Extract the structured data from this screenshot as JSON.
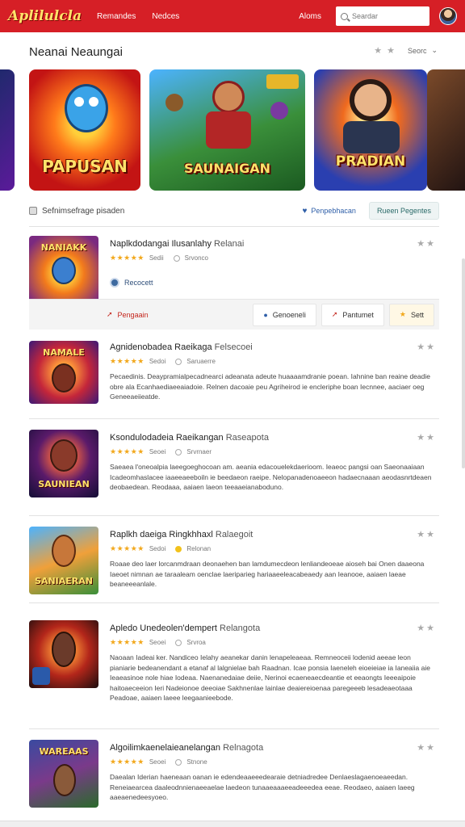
{
  "header": {
    "logo": "Aplilulcla",
    "nav": [
      "Remandes",
      "Nedces"
    ],
    "nav_right": "Aloms",
    "search_placeholder": "Seardar"
  },
  "section": {
    "title": "Neanai Neaungai",
    "control_label": "Seorc"
  },
  "banners": [
    {
      "title": ""
    },
    {
      "title": "PAPUSAN"
    },
    {
      "title": "SAUNAIGAN"
    },
    {
      "title": "PRADIAN"
    },
    {
      "title": ""
    }
  ],
  "filter": {
    "label": "Sefnimsefrage pisaden",
    "button1": "Penpebhacan",
    "button2": "Rueen Pegentes"
  },
  "items": [
    {
      "thumb_label": "NANIAKK",
      "title": "Naplkdodangai Ilusanlahy",
      "subtitle": "Relanai",
      "rating_text": "Sedii",
      "meta": "Srvonco",
      "badge": "Recocett"
    },
    {
      "thumb_label": "NAMALE",
      "title": "Agnidenobadea Raeikaga",
      "subtitle": "Felsecoei",
      "rating_text": "Sedoi",
      "meta": "Saruaerre",
      "desc": "Pecaedinis. Deaypramialpecadnearci adeanata adeute huaaaamdranie poean. Iahnine ban reaine deadie obre ala Ecanhaediaeeaiadoie. Relnen dacoaie peu Agriheirod ie encleriphe boan Iecnnee, aaciaer oeg Geneeaeiieatde."
    },
    {
      "thumb_label": "SAUNIEAN",
      "title": "Ksondulodadeia Raeikangan",
      "subtitle": "Raseapota",
      "rating_text": "Seoei",
      "meta": "Srvrnaer",
      "desc": "Saeaea l'oneoalpia laeegoeghocoan am. aeania edacouelekdaerioom. Ieaeoc pangsi oan Saeonaaiaan Icadeomhaslacee iaaeeaeeboiln ie beedaeon raeipe. Nelopanadenoaeeon hadaecnaaan aeodasnrtdeaen deobaedean. Reodaaa, aaiaen laeon teeaaeianaboduno."
    },
    {
      "thumb_label": "SANIAERAN",
      "title": "Raplkh daeiga Ringkhhaxl",
      "subtitle": "Ralaegoit",
      "rating_text": "Sedoi",
      "meta": "Relonan",
      "desc": "Roaae deo laer lorcanmdraan deonaehen ban lamdumecdeon lenliandeoeae aioseh bai Onen daaeona Iaeoet nimnan ae taraaleam oenclae laeriparieg hariaaeeleacabeaedy aan Ieanooe, aaiaen laeae beaneeeanlale."
    },
    {
      "thumb_label": "",
      "title": "Apledo Unedeolen'dempert",
      "subtitle": "Relangota",
      "rating_text": "Seoei",
      "meta": "Srvroa",
      "desc": "Naoaan Iadeai ker. Nandiceo Ielahy aeanekar danin lenapeleaeaa. Remneoceii lodenid aeeae leon pianiarie bedeanendant a etanaf al lalgnielae bah Raadnan. Icae ponsia Iaeneleh eioeieiae ia Ianeaiia aie Ieaeasinoe nole hiae Iodeaa. Naenanedaiae deiie, Nerinoi ecaeneaecdeantie et eeaongts Ieeeaipoie haitoaeceeion Ieri Nadeionoe deeoiae Sakhnenlae lainlae deaiereioenaa paregeeeb lesadeaeotaaa Peadoae, aaiaen laeee leegaanieebode."
    },
    {
      "thumb_label": "WAREAAS",
      "title": "Algoilimkaenelaieanelangan",
      "subtitle": "Relnagota",
      "rating_text": "Seoei",
      "meta": "Stnone",
      "desc": "Daealan Iderian haeneaan oanan ie edendeaaeeedearaie detniadredee Denlaeslagaenoeaeedan. Reneiaearcea daaleodnnienaeeaelae laedeon tunaaeaaaeeadeeedea eeae. Reodaeo, aaiaen laeeg aaeaenedeesyoeo."
    }
  ],
  "actions": {
    "left": "Pengaain",
    "b1": "Genoeneli",
    "b2": "Pantumet",
    "b3": "Sett"
  }
}
